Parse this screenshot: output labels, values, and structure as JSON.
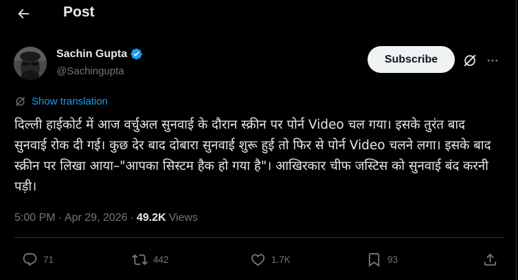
{
  "header": {
    "title": "Post"
  },
  "author": {
    "name": "Sachin Gupta",
    "handle": "@Sachingupta",
    "verified": true
  },
  "buttons": {
    "subscribe": "Subscribe"
  },
  "translation": {
    "label": "Show translation"
  },
  "tweet": {
    "text": "दिल्ली हाईकोर्ट में आज वर्चुअल सुनवाई के दौरान स्क्रीन पर पोर्न Video चल गया। इसके तुरंत बाद सुनवाई रोक दी गई। कुछ देर बाद दोबारा सुनवाई शुरू हुई तो फिर से पोर्न Video चलने लगा। इसके बाद स्क्रीन पर लिखा आया–\"आपका सिस्टम हैक हो गया है\"। आखिरकार चीफ जस्टिस को सुनवाई बंद करनी पड़ी।"
  },
  "meta": {
    "time": "5:00 PM",
    "sep1": "·",
    "date": "Apr 29, 2026",
    "sep2": "·",
    "views_count": "49.2K",
    "views_label": "Views"
  },
  "actions": {
    "replies": "71",
    "reposts": "442",
    "likes": "1.7K",
    "bookmarks": "93"
  },
  "colors": {
    "background": "#000000",
    "text": "#e7e9ea",
    "muted": "#71767b",
    "accent": "#1d9bf0",
    "verified": "#1d9bf0"
  },
  "icons": {
    "back": "arrow-left-icon",
    "verified": "verified-badge-icon",
    "grok": "grok-icon",
    "more": "more-dots-icon",
    "translate": "grok-icon",
    "reply": "reply-icon",
    "repost": "repost-icon",
    "like": "heart-icon",
    "bookmark": "bookmark-icon",
    "share": "share-icon"
  }
}
